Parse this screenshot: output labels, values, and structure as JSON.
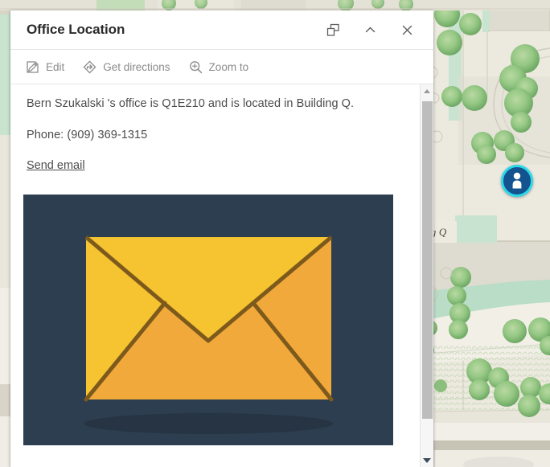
{
  "popup": {
    "title": "Office Location",
    "header_actions": [
      {
        "name": "dock-popup-button",
        "icon": "dock-icon",
        "tooltip": "Dock"
      },
      {
        "name": "collapse-popup-button",
        "icon": "chevron-up-icon",
        "tooltip": "Collapse"
      },
      {
        "name": "close-popup-button",
        "icon": "close-icon",
        "tooltip": "Close"
      }
    ],
    "toolbar": [
      {
        "label": "Edit",
        "icon": "pencil-edit-icon"
      },
      {
        "label": "Get directions",
        "icon": "directions-icon"
      },
      {
        "label": "Zoom to",
        "icon": "magnifier-plus-icon"
      }
    ],
    "body": {
      "description": "Bern Szukalski 's office is Q1E210 and is located in Building Q.",
      "phone": "Phone: (909) 369-1315",
      "email_link": "Send email"
    },
    "attachment": {
      "name": "envelope-image",
      "alt": "Yellow envelope illustration",
      "background_color": "#2d3e50",
      "flap_color": "#f5c430",
      "body_color": "#f2a93b",
      "line_color": "#7d5a1c"
    },
    "scrollbar": {
      "up_arrow": "scroll-up-arrow",
      "down_arrow": "scroll-down-arrow",
      "thumb": "scroll-thumb"
    }
  },
  "map": {
    "label": "ng Q",
    "marker": {
      "name": "office-location-marker",
      "icon": "person-icon",
      "fill_color": "#13538f",
      "ring_color": "#2ad9e8"
    },
    "colors": {
      "ground": "#ece9df",
      "building": "#dedbd0",
      "grass": "#c8e3cf",
      "path": "#f2f0e8",
      "tree": "#8cbf7e"
    }
  }
}
